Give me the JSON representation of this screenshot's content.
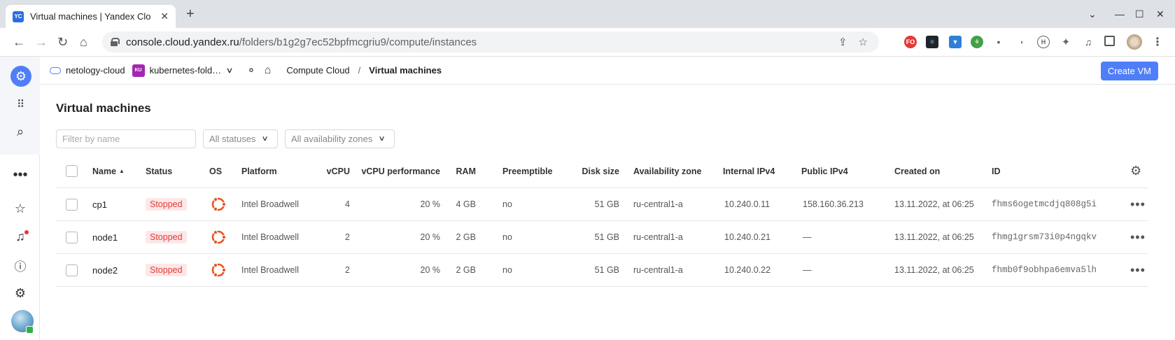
{
  "browser": {
    "tab_title": "Virtual machines | Yandex Clo",
    "tab_favicon": "YC",
    "url_host": "console.cloud.yandex.ru",
    "url_path": "/folders/b1g2g7ec52bpfmcgriu9/compute/instances"
  },
  "header": {
    "cloud": "netology-cloud",
    "folder_badge": "KU",
    "folder": "kubernetes-fold…",
    "breadcrumb_service": "Compute Cloud",
    "breadcrumb_sep": "/",
    "breadcrumb_current": "Virtual machines",
    "create_button": "Create VM"
  },
  "page": {
    "title": "Virtual machines",
    "filter_placeholder": "Filter by name",
    "status_filter": "All statuses",
    "zone_filter": "All availability zones"
  },
  "table": {
    "columns": {
      "name": "Name",
      "status": "Status",
      "os": "OS",
      "platform": "Platform",
      "vcpu": "vCPU",
      "vcpu_perf": "vCPU performance",
      "ram": "RAM",
      "preemptible": "Preemptible",
      "disk": "Disk size",
      "zone": "Availability zone",
      "internal_ip": "Internal IPv4",
      "public_ip": "Public IPv4",
      "created": "Created on",
      "id": "ID"
    },
    "rows": [
      {
        "name": "cp1",
        "status": "Stopped",
        "os_icon": "ubuntu-icon",
        "platform": "Intel Broadwell",
        "vcpu": "4",
        "vcpu_perf": "20 %",
        "ram": "4 GB",
        "preemptible": "no",
        "disk": "51 GB",
        "zone": "ru-central1-a",
        "internal_ip": "10.240.0.11",
        "public_ip": "158.160.36.213",
        "created": "13.11.2022, at 06:25",
        "id": "fhms6ogetmcdjq808g5i"
      },
      {
        "name": "node1",
        "status": "Stopped",
        "os_icon": "ubuntu-icon",
        "platform": "Intel Broadwell",
        "vcpu": "2",
        "vcpu_perf": "20 %",
        "ram": "2 GB",
        "preemptible": "no",
        "disk": "51 GB",
        "zone": "ru-central1-a",
        "internal_ip": "10.240.0.21",
        "public_ip": "—",
        "created": "13.11.2022, at 06:25",
        "id": "fhmg1grsm73i0p4ngqkv"
      },
      {
        "name": "node2",
        "status": "Stopped",
        "os_icon": "ubuntu-icon",
        "platform": "Intel Broadwell",
        "vcpu": "2",
        "vcpu_perf": "20 %",
        "ram": "2 GB",
        "preemptible": "no",
        "disk": "51 GB",
        "zone": "ru-central1-a",
        "internal_ip": "10.240.0.22",
        "public_ip": "—",
        "created": "13.11.2022, at 06:25",
        "id": "fhmb0f9obhpa6emva5lh"
      }
    ]
  },
  "colors": {
    "accent": "#4f7ef8",
    "status_stopped_bg": "#fde7e7",
    "status_stopped_text": "#e23b3b",
    "ubuntu_orange": "#e95420"
  }
}
